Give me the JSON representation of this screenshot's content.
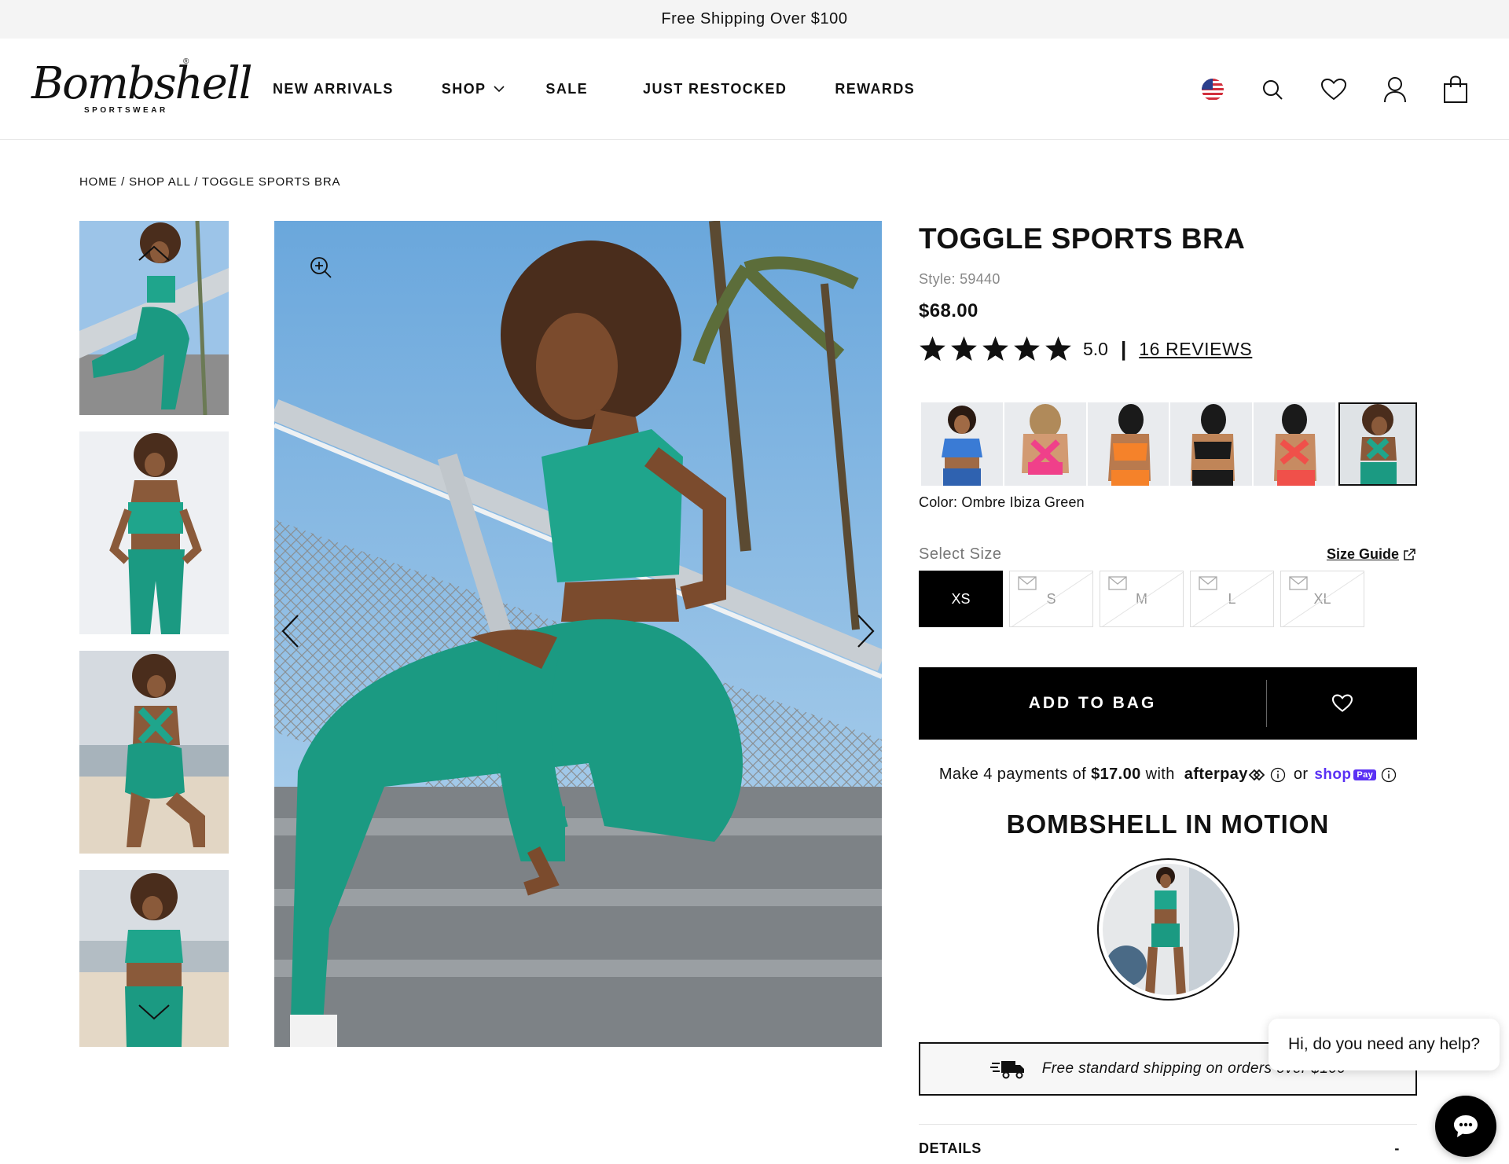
{
  "announcement": "Free Shipping Over $100",
  "brand": {
    "name": "Bombshell",
    "sub": "SPORTSWEAR",
    "reg": "®"
  },
  "nav": {
    "new_arrivals": "NEW ARRIVALS",
    "shop": "SHOP",
    "sale": "SALE",
    "just_restocked": "JUST RESTOCKED",
    "rewards": "REWARDS"
  },
  "header_icons": [
    "us-flag-icon",
    "search-icon",
    "heart-icon",
    "account-icon",
    "bag-icon"
  ],
  "breadcrumb": {
    "home": "HOME",
    "sep": " / ",
    "shop_all": "SHOP ALL",
    "current": "TOGGLE SPORTS BRA"
  },
  "product": {
    "title": "TOGGLE SPORTS BRA",
    "style": "Style: 59440",
    "price": "$68.00",
    "rating": {
      "stars": 5,
      "value": "5.0",
      "sep": "|",
      "reviews_label": "16 REVIEWS"
    },
    "color_label": "Color: Ombre Ibiza Green",
    "swatch_colors": [
      "#3a7bd5",
      "#f0408a",
      "#f5822a",
      "#1a1a1a",
      "#f0504a",
      "#1fa58c"
    ],
    "size_label": "Select Size",
    "size_guide": "Size Guide",
    "sizes": [
      {
        "label": "XS",
        "selected": true,
        "sold_out": false
      },
      {
        "label": "S",
        "selected": false,
        "sold_out": true
      },
      {
        "label": "M",
        "selected": false,
        "sold_out": true
      },
      {
        "label": "L",
        "selected": false,
        "sold_out": true
      },
      {
        "label": "XL",
        "selected": false,
        "sold_out": true
      }
    ],
    "add_to_bag": "ADD TO BAG"
  },
  "payments": {
    "prefix": "Make 4 payments of",
    "amount": "$17.00",
    "with": "with",
    "afterpay": "afterpay",
    "or": "or",
    "shop": "shop",
    "pay_badge": "Pay"
  },
  "motion_title": "BOMBSHELL IN MOTION",
  "shipping_note": "Free standard shipping on orders over $100",
  "details": {
    "label": "DETAILS",
    "toggle": "-"
  },
  "chat": {
    "greeting": "Hi, do you need any help?"
  },
  "colors": {
    "accent": "#000000",
    "product_green": "#1fa58c",
    "shoppay": "#5a31f4"
  }
}
